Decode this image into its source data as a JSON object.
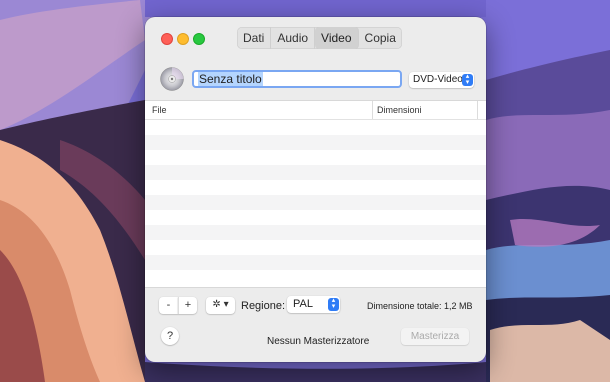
{
  "tabs": [
    {
      "label": "Dati",
      "active": false
    },
    {
      "label": "Audio",
      "active": false
    },
    {
      "label": "Video",
      "active": true
    },
    {
      "label": "Copia",
      "active": false
    }
  ],
  "title_field": {
    "value": "Senza titolo"
  },
  "format_select": {
    "value": "DVD-Video"
  },
  "table": {
    "headers": [
      "File",
      "Dimensioni"
    ],
    "rows": []
  },
  "toolbar": {
    "minus_label": "-",
    "plus_label": "+",
    "gear_label": "✲ ▾",
    "region_label": "Regione:",
    "region_value": "PAL",
    "total_size": "Dimensione totale: 1,2 MB"
  },
  "footer": {
    "help_label": "?",
    "status": "Nessun Masterizzatore",
    "burn_label": "Masterizza"
  },
  "colors": {
    "accent": "#2f7cf6",
    "focus_ring": "#7aa7f2",
    "selection": "#b4d5fe"
  }
}
